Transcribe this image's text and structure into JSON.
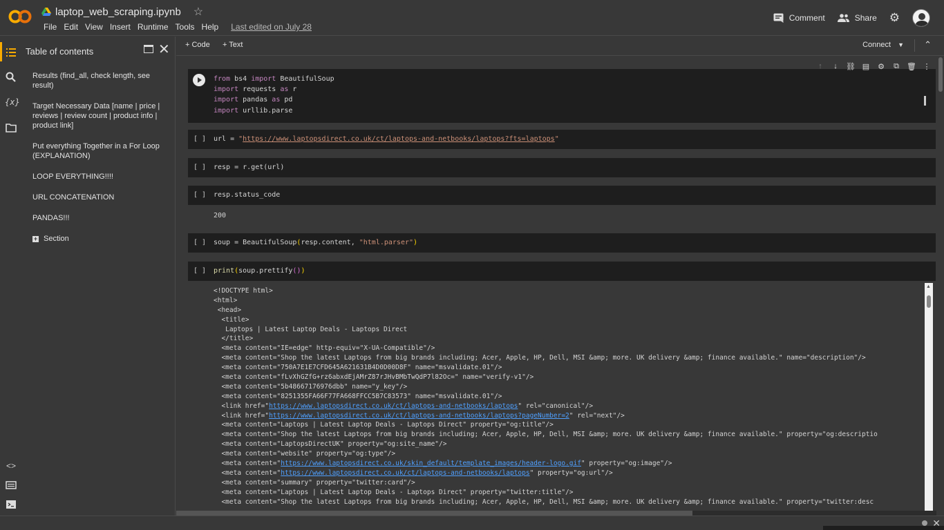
{
  "header": {
    "notebook_title": "laptop_web_scraping.ipynb",
    "menu": [
      "File",
      "Edit",
      "View",
      "Insert",
      "Runtime",
      "Tools",
      "Help"
    ],
    "last_edited": "Last edited on July 28",
    "comment_label": "Comment",
    "share_label": "Share",
    "logo_text": "CO",
    "accent_color": "#f9ab00"
  },
  "toc": {
    "title": "Table of contents",
    "items": [
      "Results (find_all, check length, see result)",
      "Target Necessary Data [name | price | reviews | review count | product info | product link]",
      "Put everything Together in a For Loop (EXPLANATION)",
      "LOOP EVERYTHING!!!!",
      "URL CONCATENATION",
      "PANDAS!!!"
    ],
    "section_label": "Section"
  },
  "toolbar": {
    "code_label": "+ Code",
    "text_label": "+ Text",
    "connect_label": "Connect"
  },
  "cells": {
    "c1": {
      "l1_kw1": "from",
      "l1_mod": " bs4 ",
      "l1_kw2": "import",
      "l1_rest": " BeautifulSoup",
      "l2_kw1": "import",
      "l2_mod": " requests ",
      "l2_kw2": "as",
      "l2_rest": " r",
      "l3_kw1": "import",
      "l3_mod": " pandas ",
      "l3_kw2": "as",
      "l3_rest": " pd",
      "l4_kw1": "import",
      "l4_rest": " urllib.parse"
    },
    "c2": {
      "prefix": "url = ",
      "q1": "\"",
      "url": "https://www.laptopsdirect.co.uk/ct/laptops-and-netbooks/laptops?fts=laptops",
      "q2": "\""
    },
    "c3": {
      "code": "resp = r.get(url)"
    },
    "c4": {
      "code": "resp.status_code",
      "output": "200"
    },
    "c5": {
      "prefix": "soup = BeautifulSoup",
      "open": "(",
      "args": "resp.content, ",
      "str": "\"html.parser\"",
      "close": ")"
    },
    "c6": {
      "fn": "print",
      "open": "(",
      "args": "soup.prettify",
      "inner": "()",
      "close": ")"
    },
    "bracket": "[ ]"
  },
  "output_lines": [
    {
      "a": "<!DOCTYPE html>"
    },
    {
      "a": "<html>"
    },
    {
      "a": " <head>"
    },
    {
      "a": "  <title>"
    },
    {
      "a": "   Laptops | Latest Laptop Deals - Laptops Direct"
    },
    {
      "a": "  </title>"
    },
    {
      "a": "  <meta content=\"IE=edge\" http-equiv=\"X-UA-Compatible\"/>"
    },
    {
      "a": "  <meta content=\"Shop the latest Laptops from big brands including; Acer, Apple, HP, Dell, MSI &amp; more. UK delivery &amp; finance available.\" name=\"description\"/>"
    },
    {
      "a": "  <meta content=\"750A7E1E7CFD645A621631B4D0D00D8F\" name=\"msvalidate.01\"/>"
    },
    {
      "a": "  <meta content=\"fLvXhGZfG+rz6abxdEjAMrZ87rJHvBMbTwQdP7l82Oc=\" name=\"verify-v1\"/>"
    },
    {
      "a": "  <meta content=\"5b48667176976dbb\" name=\"y_key\"/>"
    },
    {
      "a": "  <meta content=\"8251355FA66F77FA668FFCC5B7C83573\" name=\"msvalidate.01\"/>"
    },
    {
      "a": "  <link href=\"",
      "link": "https://www.laptopsdirect.co.uk/ct/laptops-and-netbooks/laptops",
      "b": "\" rel=\"canonical\"/>"
    },
    {
      "a": "  <link href=\"",
      "link": "https://www.laptopsdirect.co.uk/ct/laptops-and-netbooks/laptops?pageNumber=2",
      "b": "\" rel=\"next\"/>"
    },
    {
      "a": "  <meta content=\"Laptops | Latest Laptop Deals - Laptops Direct\" property=\"og:title\"/>"
    },
    {
      "a": "  <meta content=\"Shop the latest Laptops from big brands including; Acer, Apple, HP, Dell, MSI &amp; more. UK delivery &amp; finance available.\" property=\"og:descriptio"
    },
    {
      "a": "  <meta content=\"LaptopsDirectUK\" property=\"og:site_name\"/>"
    },
    {
      "a": "  <meta content=\"website\" property=\"og:type\"/>"
    },
    {
      "a": "  <meta content=\"",
      "link": "https://www.laptopsdirect.co.uk/skin_default/template_images/header-logo.gif",
      "b": "\" property=\"og:image\"/>"
    },
    {
      "a": "  <meta content=\"",
      "link": "https://www.laptopsdirect.co.uk/ct/laptops-and-netbooks/laptops",
      "b": "\" property=\"og:url\"/>"
    },
    {
      "a": "  <meta content=\"summary\" property=\"twitter:card\"/>"
    },
    {
      "a": "  <meta content=\"Laptops | Latest Laptop Deals - Laptops Direct\" property=\"twitter:title\"/>"
    },
    {
      "a": "  <meta content=\"Shop the latest Laptops from big brands including; Acer, Apple, HP, Dell, MSI &amp; more. UK delivery &amp; finance available.\" property=\"twitter:desc"
    }
  ]
}
